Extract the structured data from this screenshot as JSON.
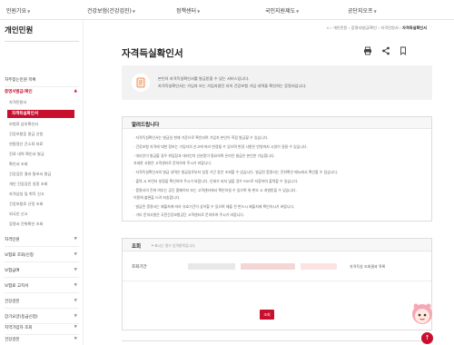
{
  "gnb": {
    "items": [
      {
        "label": "민원기요"
      },
      {
        "label": "건강보험(건강검진)"
      },
      {
        "label": "정책센터"
      },
      {
        "label": "국민지원제도"
      },
      {
        "label": "공단지오프"
      }
    ]
  },
  "sidebar": {
    "title": "개인민원",
    "items": [
      {
        "label": "자주찾는민원 목록",
        "level": "major"
      },
      {
        "label": "증명서발급/확인",
        "level": "red"
      },
      {
        "label": "자격민원서",
        "level": "sub"
      },
      {
        "label": "자격득실확인서",
        "level": "active"
      },
      {
        "label": "보험료 납부확인서",
        "level": "sub"
      },
      {
        "label": "건강보험증 발급 신청",
        "level": "sub"
      },
      {
        "label": "연말정산 간소화 자료",
        "level": "sub"
      },
      {
        "label": "진료 내역 확인서 발급",
        "level": "sub"
      },
      {
        "label": "확인서 조회",
        "level": "sub"
      },
      {
        "label": "건강검진 결과 통보서 발급",
        "level": "sub"
      },
      {
        "label": "개인 건강검진 일정 조회",
        "level": "sub"
      },
      {
        "label": "자격상실 및 취득 신고",
        "level": "sub"
      },
      {
        "label": "건강보험료 산정 조회",
        "level": "sub"
      },
      {
        "label": "외국인 신고",
        "level": "sub"
      },
      {
        "label": "증명서 진위확인 조회",
        "level": "sub"
      },
      {
        "label": "자격민원",
        "level": "major"
      },
      {
        "label": "보험료 조회/신청",
        "level": "major"
      },
      {
        "label": "보험급여",
        "level": "major"
      },
      {
        "label": "보험료 고지서",
        "level": "major"
      },
      {
        "label": "건강검진",
        "level": "major"
      },
      {
        "label": "장기요양(등급신청)",
        "level": "major"
      },
      {
        "label": "지역가입자 조회",
        "level": "major"
      },
      {
        "label": "건강검진",
        "level": "major"
      }
    ]
  },
  "breadcrumb": {
    "home": "⌂",
    "items": [
      "개인민원",
      "증명서발급/확인",
      "자격민원서"
    ],
    "current": "자격득실확인서"
  },
  "page": {
    "title": "자격득실확인서"
  },
  "toolbar": {
    "icons": [
      "printer-icon",
      "share-icon",
      "bookmark-icon"
    ]
  },
  "infobox": {
    "line1": "본인의 자격득실확인서를 발급받을 수 있는 서비스입니다.",
    "line2": "자격득실확인서는 가입자 또는 가입자였던 자의 건강보험 가입 내역을 확인하는 증명서입니다."
  },
  "notice": {
    "title": "알려드립니다",
    "lines": [
      "· 자격득실확인서는 발급일 현재 기준으로 확인되며 가입자 본인이 직접 발급할 수 있습니다.",
      "· 건강보험 자격에 대한 정보는 가입자의 신고에 따라 변경될 수 있으며 변경 사항은 반영까지 시일이 걸릴 수 있습니다.",
      "· 대리인이 발급할 경우 위임장과 대리인의 신분증이 필요하며 온라인 발급은 본인만 가능합니다.",
      "  자세한 사항은 고객센터로 문의하여 주시기 바랍니다.",
      "· 자격득실확인서의 발급 내역은 발급일로부터 일정 기간 동안 조회할 수 있습니다. 발급된 증명서는 진위확인 메뉴에서 확인할 수 있습니다.",
      "· 출력 시 프린터 설정을 확인하여 주시기 바랍니다. 인쇄가 되지 않을 경우 PDF로 저장하여 출력할 수 있습니다.",
      "· 증명서의 진위 여부는 공단 홈페이지 또는 고객센터에서 확인하실 수 있으며 위·변조 시 처벌받을 수 있습니다.",
      "  이용에 불편을 드려 죄송합니다.",
      "· 발급된 증명서는 제출처에 따라 유효기간이 상이할 수 있으며 제출 전 반드시 제출처에 확인하시기 바랍니다.",
      "· 기타 문의사항은 국민건강보험공단 고객센터로 문의하여 주시기 바랍니다."
    ]
  },
  "query": {
    "title": "조회",
    "note": "표시는 필수 입력항목입니다.",
    "row_label": "조회기간",
    "result_text": "자격득실 조회결과 목록",
    "search_label": "조회"
  },
  "colors": {
    "accent": "#c8102e",
    "panel": "#f2f2f2"
  }
}
